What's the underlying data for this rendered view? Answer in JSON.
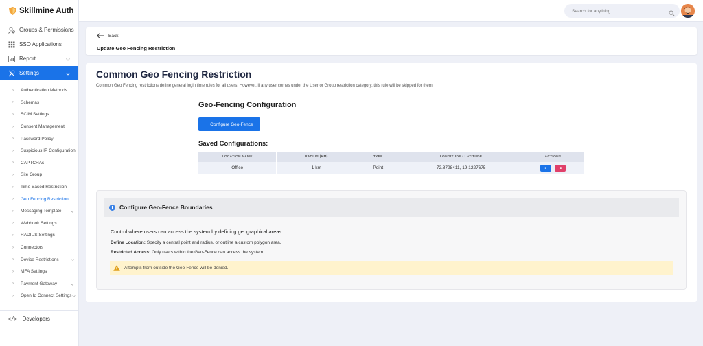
{
  "app": {
    "name": "Skillmine Auth"
  },
  "sidebar": {
    "items": [
      {
        "label": "Groups & Permissions",
        "icon": "users-icon",
        "has_chevron": true
      },
      {
        "label": "SSO Applications",
        "icon": "grid-icon",
        "has_chevron": false
      },
      {
        "label": "Report",
        "icon": "chart-icon",
        "has_chevron": true
      },
      {
        "label": "Settings",
        "icon": "tools-icon",
        "has_chevron": true,
        "active": true
      }
    ],
    "sub_items": [
      {
        "label": "Authentication Methods"
      },
      {
        "label": "Schemas"
      },
      {
        "label": "SCIM Settings"
      },
      {
        "label": "Consent Management"
      },
      {
        "label": "Password Policy"
      },
      {
        "label": "Suspicious IP Configuration"
      },
      {
        "label": "CAPTCHAs"
      },
      {
        "label": "Site Group"
      },
      {
        "label": "Time Based Restriction"
      },
      {
        "label": "Geo Fencing Restriction",
        "active": true
      },
      {
        "label": "Messaging Template",
        "has_chevron": true
      },
      {
        "label": "Webhook Settings"
      },
      {
        "label": "RADIUS Settings"
      },
      {
        "label": "Connectors"
      },
      {
        "label": "Device Restrictions",
        "has_chevron": true
      },
      {
        "label": "MFA Settings"
      },
      {
        "label": "Payment Gateway",
        "has_chevron": true
      },
      {
        "label": "Open Id Connect Settings",
        "has_chevron": true
      }
    ],
    "developers": "Developers"
  },
  "topbar": {
    "search_placeholder": "Search for anything..."
  },
  "header": {
    "back_label": "Back",
    "title": "Update Geo Fencing Restriction"
  },
  "main": {
    "title": "Common Geo Fencing Restriction",
    "description": "Common Geo Fencing restrictions define general login time rules for all users. However, if any user comes under the User or Group restriction category, this rule will be skipped for them.",
    "config_title": "Geo-Fencing Configuration",
    "configure_button": "Configure Geo-Fence",
    "saved_title": "Saved Configurations:",
    "table": {
      "headers": [
        "LOCATION NAME",
        "RADIUS (KM)",
        "TYPE",
        "LONGITUDE / LATITUDE",
        "ACTIONS"
      ],
      "rows": [
        {
          "location": "Office",
          "radius": "1 km",
          "type": "Point",
          "coords": "72.8798411, 19.1227675"
        }
      ]
    }
  },
  "info": {
    "title": "Configure Geo-Fence Boundaries",
    "lead": "Control where users can access the system by defining geographical areas.",
    "define_label": "Define Location:",
    "define_text": " Specify a central point and radius, or outline a custom polygon area.",
    "restricted_label": "Restricted Access:",
    "restricted_text": " Only users within the Geo-Fence can access the system.",
    "warning": "Attempts from outside the Geo-Fence will be denied."
  },
  "colors": {
    "primary": "#1a73e8",
    "danger": "#e0406a",
    "warning_bg": "#fff3cd",
    "brand": "#f4a63a"
  }
}
